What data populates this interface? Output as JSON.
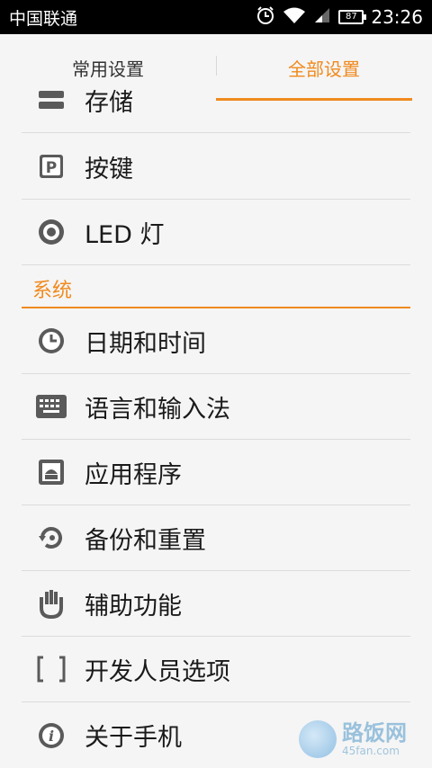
{
  "status_bar": {
    "carrier": "中国联通",
    "battery": "87",
    "time": "23:26",
    "icons": [
      "alarm-icon",
      "wifi-icon",
      "signal-icon",
      "battery-icon"
    ]
  },
  "tabs": [
    {
      "label": "常用设置",
      "active": false
    },
    {
      "label": "全部设置",
      "active": true
    }
  ],
  "partial_item": {
    "label": "存储",
    "icon": "storage-icon"
  },
  "items_top": [
    {
      "label": "按键",
      "icon": "key-icon"
    },
    {
      "label": "LED 灯",
      "icon": "led-icon"
    }
  ],
  "section": {
    "title": "系统"
  },
  "items_system": [
    {
      "label": "日期和时间",
      "icon": "clock-icon"
    },
    {
      "label": "语言和输入法",
      "icon": "keyboard-icon"
    },
    {
      "label": "应用程序",
      "icon": "android-app-icon"
    },
    {
      "label": "备份和重置",
      "icon": "backup-icon"
    },
    {
      "label": "辅助功能",
      "icon": "hand-icon"
    },
    {
      "label": "开发人员选项",
      "icon": "brackets-icon"
    },
    {
      "label": "关于手机",
      "icon": "info-icon"
    }
  ],
  "watermark": {
    "main": "路饭网",
    "sub": "45fan.com"
  },
  "colors": {
    "accent": "#f08a1e",
    "icon": "#5a5a5a",
    "divider": "#dcdcdc"
  }
}
